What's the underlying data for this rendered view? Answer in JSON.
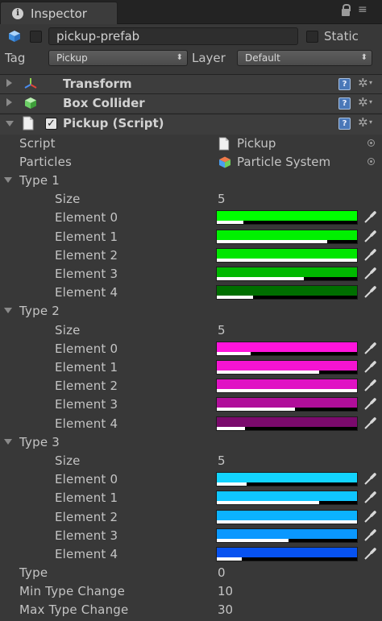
{
  "window": {
    "tab_label": "Inspector"
  },
  "object": {
    "name": "pickup-prefab",
    "static_label": "Static"
  },
  "tag": {
    "label": "Tag",
    "value": "Pickup"
  },
  "layer": {
    "label": "Layer",
    "value": "Default"
  },
  "components": {
    "transform": {
      "title": "Transform"
    },
    "box_collider": {
      "title": "Box Collider"
    },
    "pickup_script": {
      "title": "Pickup (Script)",
      "enabled": true
    }
  },
  "script_field": {
    "label": "Script",
    "value": "Pickup"
  },
  "particles_field": {
    "label": "Particles",
    "value": "Particle System"
  },
  "types": [
    {
      "label": "Type 1",
      "size_label": "Size",
      "size": "5",
      "elements": [
        {
          "label": "Element 0",
          "color": "#00ff00",
          "alpha": 0.19
        },
        {
          "label": "Element 1",
          "color": "#00f000",
          "alpha": 0.79
        },
        {
          "label": "Element 2",
          "color": "#00e600",
          "alpha": 1.0
        },
        {
          "label": "Element 3",
          "color": "#00b800",
          "alpha": 0.62
        },
        {
          "label": "Element 4",
          "color": "#006e00",
          "alpha": 0.26
        }
      ]
    },
    {
      "label": "Type 2",
      "size_label": "Size",
      "size": "5",
      "elements": [
        {
          "label": "Element 0",
          "color": "#ff14dc",
          "alpha": 0.24
        },
        {
          "label": "Element 1",
          "color": "#f514d2",
          "alpha": 0.73
        },
        {
          "label": "Element 2",
          "color": "#e012c4",
          "alpha": 1.0
        },
        {
          "label": "Element 3",
          "color": "#b00e9a",
          "alpha": 0.56
        },
        {
          "label": "Element 4",
          "color": "#7a0a6c",
          "alpha": 0.2
        }
      ]
    },
    {
      "label": "Type 3",
      "size_label": "Size",
      "size": "5",
      "elements": [
        {
          "label": "Element 0",
          "color": "#12d4ff",
          "alpha": 0.21
        },
        {
          "label": "Element 1",
          "color": "#0fc6ff",
          "alpha": 0.73
        },
        {
          "label": "Element 2",
          "color": "#0bb2ff",
          "alpha": 1.0
        },
        {
          "label": "Element 3",
          "color": "#0a98ff",
          "alpha": 0.51
        },
        {
          "label": "Element 4",
          "color": "#0752f0",
          "alpha": 0.18
        }
      ]
    }
  ],
  "type_field": {
    "label": "Type",
    "value": "0"
  },
  "min_type_change": {
    "label": "Min Type Change",
    "value": "10"
  },
  "max_type_change": {
    "label": "Max Type Change",
    "value": "30"
  },
  "icons": {
    "tab": "info-icon",
    "lock": "lock-icon",
    "menu": "menu-icon",
    "object": "cube-icon",
    "transform": "transform-axes-icon",
    "box_collider": "box-collider-icon",
    "script": "script-file-icon",
    "particles": "particle-system-icon",
    "help": "help-icon",
    "gear": "gear-icon",
    "eyedropper": "eyedropper-icon"
  }
}
